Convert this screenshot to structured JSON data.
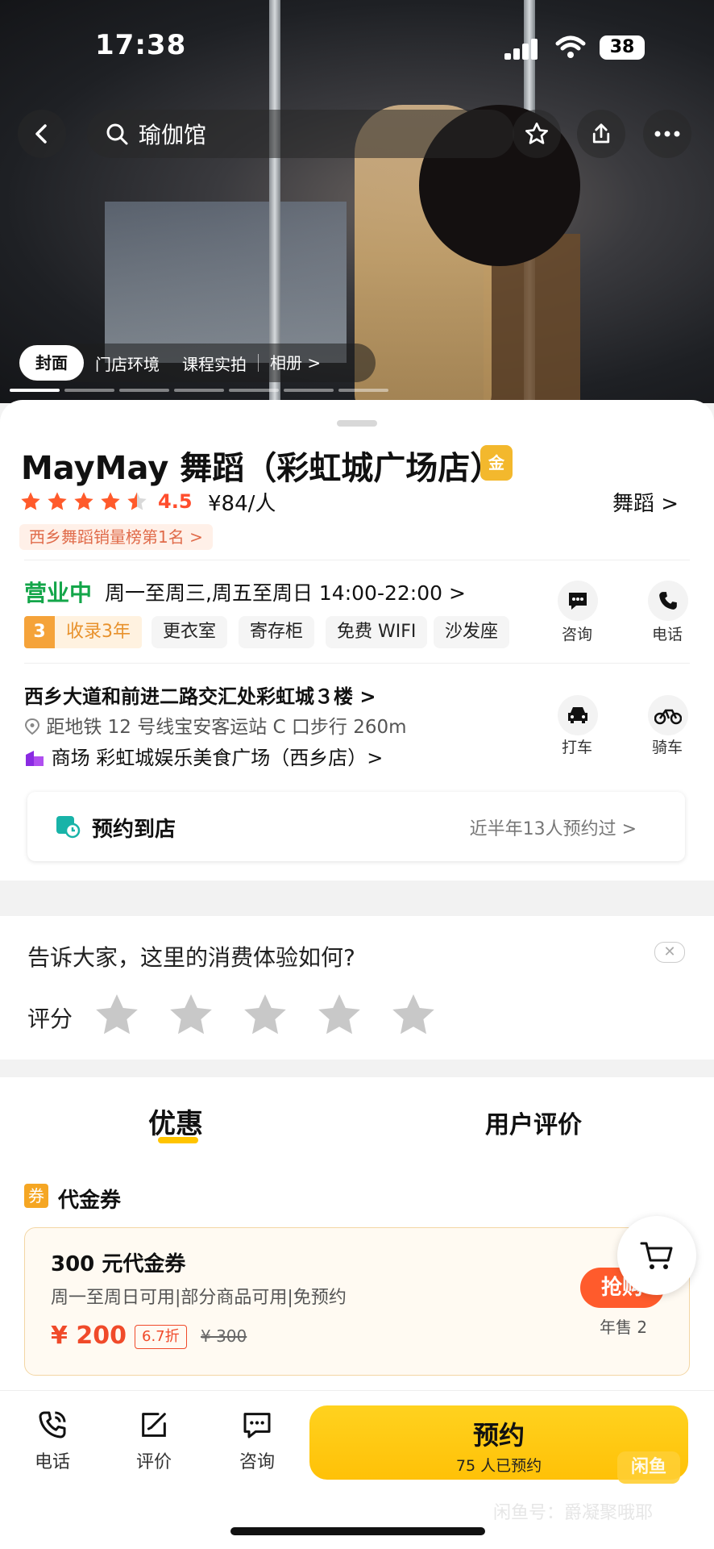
{
  "status_bar": {
    "time": "17:38",
    "battery": "38"
  },
  "hero": {
    "search_text": "瑜伽馆",
    "gallery_tabs": [
      "封面",
      "门店环境",
      "课程实拍",
      "相册 >"
    ]
  },
  "shop": {
    "name": "MayMay 舞蹈（彩虹城广场店）",
    "badge": "金",
    "rating": "4.5",
    "rating_value": 4.5,
    "price": "¥84/人",
    "category": "舞蹈 >",
    "rank_tag": "西乡舞蹈销量榜第1名 >"
  },
  "hours": {
    "status": "营业中",
    "text": "周一至周三,周五至周日 14:00-22:00 >"
  },
  "actions": {
    "consult": "咨询",
    "call": "电话",
    "taxi": "打车",
    "bike": "骑车"
  },
  "tags": {
    "years_num": "3",
    "years_text": "收录3年",
    "facilities": [
      "更衣室",
      "寄存柜",
      "免费 WIFI",
      "沙发座"
    ]
  },
  "address": {
    "line": "西乡大道和前进二路交汇处彩虹城３楼 >",
    "metro": "距地铁 12 号线宝安客运站 C 口步行 260m",
    "mall": "商场  彩虹城娱乐美食广场（西乡店）>"
  },
  "booking": {
    "title": "预约到店",
    "stat": "近半年13人预约过  >"
  },
  "feedback": {
    "question": "告诉大家，这里的消费体验如何?",
    "close": "✕",
    "label": "评分"
  },
  "tabs": {
    "deals": "优惠",
    "reviews": "用户评价"
  },
  "voucher": {
    "section_icon": "券",
    "section": "代金券",
    "title": "300 元代金券",
    "desc": "周一至周日可用|部分商品可用|免预约",
    "price": "¥ 200",
    "discount": "6.7折",
    "original": "¥ 300",
    "buy": "抢购",
    "sold": "年售 2"
  },
  "bottom_bar": {
    "call": "电话",
    "review": "评价",
    "consult": "咨询",
    "reserve": "预约",
    "reserve_sub": "75 人已预约"
  },
  "watermark": {
    "logo": "闲鱼",
    "text": "闲鱼号：爵凝聚哦耶"
  },
  "colors": {
    "accent": "#ffc400",
    "open": "#14a64a",
    "price": "#f04a2a"
  }
}
